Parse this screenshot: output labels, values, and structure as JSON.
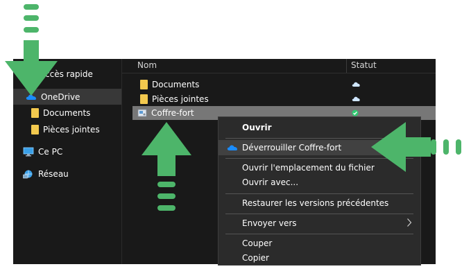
{
  "sidebar": {
    "items": [
      {
        "label": "Accès rapide",
        "icon": "star-icon"
      },
      {
        "label": "OneDrive",
        "icon": "onedrive-cloud-icon"
      },
      {
        "label": "Documents",
        "icon": "folder-icon"
      },
      {
        "label": "Pièces jointes",
        "icon": "folder-icon"
      },
      {
        "label": "Ce PC",
        "icon": "computer-icon"
      },
      {
        "label": "Réseau",
        "icon": "network-icon"
      }
    ]
  },
  "filelist": {
    "headers": {
      "name": "Nom",
      "status": "Statut"
    },
    "rows": [
      {
        "name": "Documents",
        "icon": "folder-icon",
        "status_icon": "cloud-status-icon"
      },
      {
        "name": "Pièces jointes",
        "icon": "folder-icon",
        "status_icon": "cloud-status-icon"
      },
      {
        "name": "Coffre-fort",
        "icon": "vault-icon",
        "status_icon": "check-status-icon"
      }
    ]
  },
  "context_menu": {
    "items": [
      {
        "label": "Ouvrir"
      },
      {
        "label": "Déverrouiller Coffre-fort"
      },
      {
        "label": "Ouvrir l'emplacement du fichier"
      },
      {
        "label": "Ouvrir avec..."
      },
      {
        "label": "Restaurer les versions précédentes"
      },
      {
        "label": "Envoyer vers"
      },
      {
        "label": "Couper"
      },
      {
        "label": "Copier"
      }
    ]
  },
  "colors": {
    "window_bg": "#191919",
    "selection": "#777777",
    "menu_bg": "#2b2b2b",
    "arrow_green": "#4db56a",
    "onedrive_blue": "#1a8cff"
  }
}
